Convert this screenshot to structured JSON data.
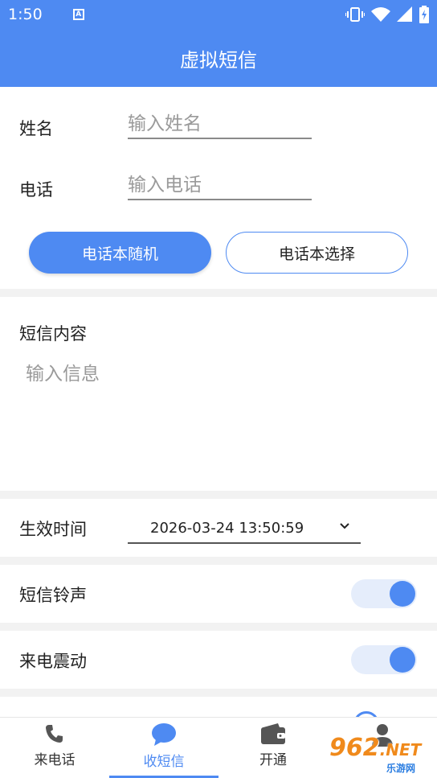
{
  "status_bar": {
    "time": "1:50",
    "notification_icon": "a-icon",
    "icons": [
      "vibrate-icon",
      "wifi-icon",
      "signal-icon",
      "battery-charging-icon"
    ]
  },
  "app_bar": {
    "title": "虚拟短信"
  },
  "contact": {
    "name_label": "姓名",
    "name_placeholder": "输入姓名",
    "name_value": "",
    "phone_label": "电话",
    "phone_placeholder": "输入电话",
    "phone_value": "",
    "random_button": "电话本随机",
    "select_button": "电话本选择"
  },
  "message": {
    "label": "短信内容",
    "placeholder": "输入信息",
    "value": ""
  },
  "effective_time": {
    "label": "生效时间",
    "value": "2026-03-24 13:50:59"
  },
  "sms_ringtone": {
    "label": "短信铃声",
    "enabled": true
  },
  "call_vibration": {
    "label": "来电震动",
    "enabled": true
  },
  "bottom_nav": {
    "items": [
      {
        "label": "来电话",
        "icon": "phone-icon",
        "active": false
      },
      {
        "label": "收短信",
        "icon": "chat-bubble-icon",
        "active": true
      },
      {
        "label": "开通",
        "icon": "wallet-icon",
        "active": false
      },
      {
        "label": "",
        "icon": "user-icon",
        "active": false
      }
    ]
  },
  "watermark": {
    "text": "962",
    "suffix": ".NET",
    "sub": "乐游网"
  },
  "colors": {
    "primary": "#4e8af2",
    "toggle_track": "#e5edfb",
    "background": "#f2f2f2"
  }
}
